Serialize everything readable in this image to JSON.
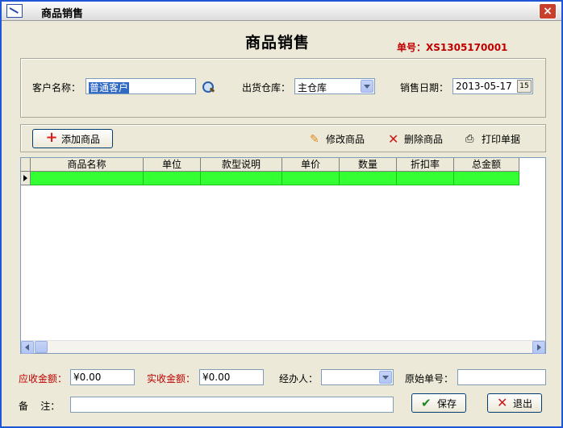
{
  "window": {
    "title": "商品销售"
  },
  "form": {
    "title": "商品销售",
    "order_no": "单号：XS1305170001"
  },
  "header": {
    "customer_label": "客户名称：",
    "customer_value": "普通客户",
    "warehouse_label": "出货仓库：",
    "warehouse_value": "主仓库",
    "date_label": "销售日期：",
    "date_value": "2013-05-17",
    "calendar_glyph": "15"
  },
  "toolbar": {
    "add_label": "添加商品",
    "edit_label": "修改商品",
    "delete_label": "删除商品",
    "print_label": "打印单据"
  },
  "grid": {
    "columns": [
      "商品名称",
      "单位",
      "款型说明",
      "单价",
      "数量",
      "折扣率",
      "总金额"
    ]
  },
  "footer": {
    "receivable_label": "应收金额：",
    "receivable_value": "¥0.00",
    "received_label": "实收金额：",
    "received_value": "¥0.00",
    "handler_label": "经办人：",
    "handler_value": "",
    "original_label": "原始单号：",
    "original_value": "",
    "remark_label": "备    注：",
    "remark_value": "",
    "save_label": "保存",
    "exit_label": "退出"
  },
  "colors": {
    "accent_red": "#c00000",
    "row_green": "#33ff33",
    "title_blue": "#1f56d6"
  },
  "icons": [
    "app-icon",
    "close-icon",
    "search-icon",
    "plus-icon",
    "pencil-icon",
    "delete-icon",
    "printer-icon",
    "check-icon",
    "x-icon",
    "calendar-icon"
  ]
}
